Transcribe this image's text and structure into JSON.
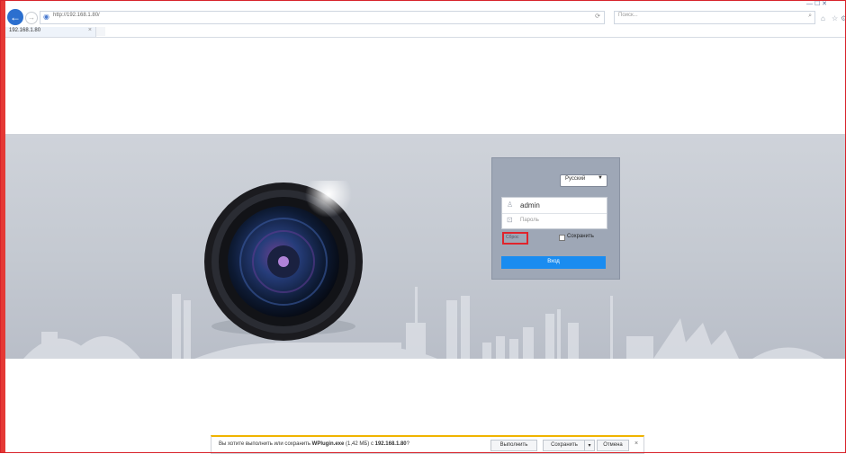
{
  "browser": {
    "url": "http://192.168.1.80/",
    "search_placeholder": "Поиск...",
    "tab_title": "192.168.1.80",
    "back_glyph": "←",
    "fwd_glyph": "→",
    "window_controls": "— ☐ ✕"
  },
  "login": {
    "language": "Русский",
    "username": "admin",
    "password_placeholder": "Пароль",
    "reset_label": "Сброс",
    "remember_label": "Сохранить",
    "login_button": "Вход"
  },
  "download": {
    "message_prefix": "Вы хотите выполнить или сохранить ",
    "file_name": "WPlugin.exe",
    "message_mid": " (1,42 МБ) с ",
    "host": "192.168.1.80",
    "message_suffix": "?",
    "run_label": "Выполнить",
    "save_label": "Сохранить",
    "cancel_label": "Отмена"
  },
  "colors": {
    "accent": "#1a8cf0",
    "highlight": "#e0242c",
    "panel": "#9ea7b6"
  }
}
